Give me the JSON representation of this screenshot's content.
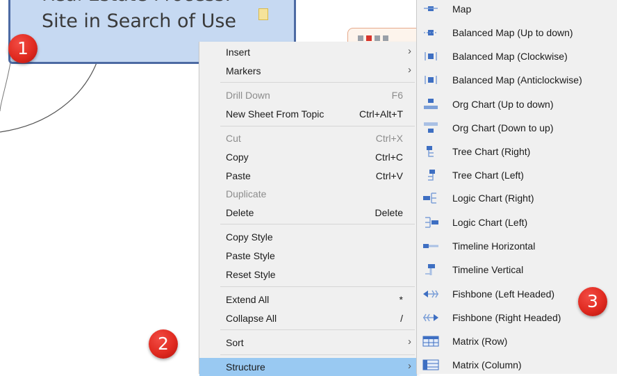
{
  "topic": {
    "line1": "Real Estate Process:",
    "line2": "Site in Search of Use"
  },
  "callouts": [
    "1",
    "2",
    "3"
  ],
  "menu": {
    "items": [
      {
        "label": "Insert",
        "shortcut": "",
        "arrow": "›",
        "disabled": false
      },
      {
        "label": "Markers",
        "shortcut": "",
        "arrow": "›",
        "disabled": false
      },
      {
        "label": "Drill Down",
        "shortcut": "F6",
        "arrow": "",
        "disabled": true
      },
      {
        "label": "New Sheet From Topic",
        "shortcut": "Ctrl+Alt+T",
        "arrow": "",
        "disabled": false
      },
      {
        "label": "Cut",
        "shortcut": "Ctrl+X",
        "arrow": "",
        "disabled": true
      },
      {
        "label": "Copy",
        "shortcut": "Ctrl+C",
        "arrow": "",
        "disabled": false
      },
      {
        "label": "Paste",
        "shortcut": "Ctrl+V",
        "arrow": "",
        "disabled": false
      },
      {
        "label": "Duplicate",
        "shortcut": "",
        "arrow": "",
        "disabled": true
      },
      {
        "label": "Delete",
        "shortcut": "Delete",
        "arrow": "",
        "disabled": false
      },
      {
        "label": "Copy Style",
        "shortcut": "",
        "arrow": "",
        "disabled": false
      },
      {
        "label": "Paste Style",
        "shortcut": "",
        "arrow": "",
        "disabled": false
      },
      {
        "label": "Reset Style",
        "shortcut": "",
        "arrow": "",
        "disabled": false
      },
      {
        "label": "Extend All",
        "shortcut": "*",
        "arrow": "",
        "disabled": false
      },
      {
        "label": "Collapse All",
        "shortcut": "/",
        "arrow": "",
        "disabled": false
      },
      {
        "label": "Sort",
        "shortcut": "",
        "arrow": "›",
        "disabled": false
      },
      {
        "label": "Structure",
        "shortcut": "",
        "arrow": "›",
        "disabled": false
      }
    ]
  },
  "submenu": {
    "items": [
      {
        "label": "Map",
        "icon": "map-structure-icon"
      },
      {
        "label": "Balanced Map (Up to down)",
        "icon": "balanced-map-up-down-icon"
      },
      {
        "label": "Balanced Map (Clockwise)",
        "icon": "balanced-map-clockwise-icon"
      },
      {
        "label": "Balanced Map (Anticlockwise)",
        "icon": "balanced-map-anticlockwise-icon"
      },
      {
        "label": "Org Chart (Up to down)",
        "icon": "org-chart-up-down-icon"
      },
      {
        "label": "Org Chart (Down to up)",
        "icon": "org-chart-down-up-icon"
      },
      {
        "label": "Tree Chart (Right)",
        "icon": "tree-chart-right-icon"
      },
      {
        "label": "Tree Chart (Left)",
        "icon": "tree-chart-left-icon"
      },
      {
        "label": "Logic Chart (Right)",
        "icon": "logic-chart-right-icon"
      },
      {
        "label": "Logic Chart (Left)",
        "icon": "logic-chart-left-icon"
      },
      {
        "label": "Timeline Horizontal",
        "icon": "timeline-horizontal-icon"
      },
      {
        "label": "Timeline Vertical",
        "icon": "timeline-vertical-icon"
      },
      {
        "label": "Fishbone (Left Headed)",
        "icon": "fishbone-left-icon"
      },
      {
        "label": "Fishbone (Right Headed)",
        "icon": "fishbone-right-icon"
      },
      {
        "label": "Matrix (Row)",
        "icon": "matrix-row-icon"
      },
      {
        "label": "Matrix (Column)",
        "icon": "matrix-column-icon"
      }
    ]
  },
  "colors": {
    "topic_fill": "#c6d9f2",
    "topic_border": "#4d6aa3",
    "menu_bg": "#f0f0f0",
    "highlight": "#99c9f2",
    "callout": "#e02a20",
    "icon_blue": "#3e6fc2"
  }
}
